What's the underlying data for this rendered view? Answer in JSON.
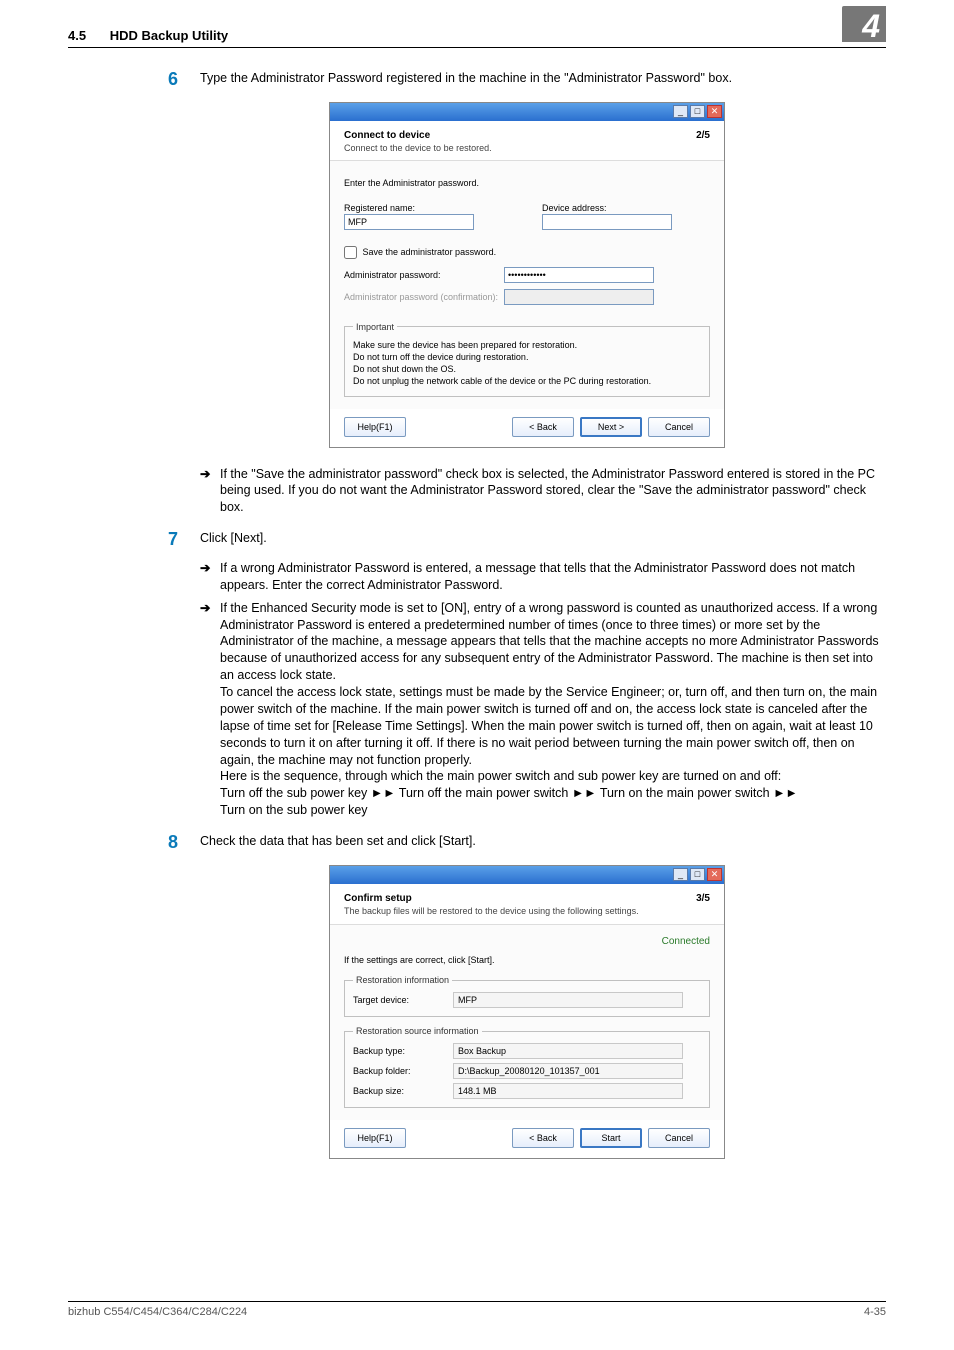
{
  "header": {
    "section_number": "4.5",
    "section_title": "HDD Backup Utility",
    "chapter_badge": "4"
  },
  "step6": {
    "num": "6",
    "text": "Type the Administrator Password registered in the machine in the \"Administrator Password\" box.",
    "arrow_text": "If the \"Save the administrator password\" check box is selected, the Administrator Password entered is stored in the PC being used. If you do not want the Administrator Password stored, clear the \"Save the administrator password\" check box."
  },
  "dlg1": {
    "title": "Connect to device",
    "subtitle": "Connect to the device to be restored.",
    "page_indicator": "2/5",
    "instruction": "Enter the Administrator password.",
    "reg_name_label": "Registered name:",
    "reg_name_value": "MFP",
    "dev_addr_label": "Device address:",
    "dev_addr_value": "",
    "save_pw_label": "Save the administrator password.",
    "admin_pw_label": "Administrator password:",
    "admin_pw_value": "••••••••••••",
    "admin_pw_conf_label": "Administrator password (confirmation):",
    "important_legend": "Important",
    "important_line1": "Make sure the device has been prepared for restoration.",
    "important_line2": "Do not turn off the device during restoration.",
    "important_line3": "Do not shut down the OS.",
    "important_line4": "Do not unplug the network cable of the device or the PC during restoration.",
    "btn_help": "Help(F1)",
    "btn_back": "< Back",
    "btn_next": "Next >",
    "btn_cancel": "Cancel"
  },
  "step7": {
    "num": "7",
    "text": "Click [Next].",
    "arrow1": "If a wrong Administrator Password is entered, a message that tells that the Administrator Password does not match appears. Enter the correct Administrator Password.",
    "arrow2_p1": "If the Enhanced Security mode is set to [ON], entry of a wrong password is counted as unauthorized access. If a wrong Administrator Password is entered a predetermined number of times (once to three times) or more set by the Administrator of the machine, a message appears that tells that the machine accepts no more Administrator Passwords because of unauthorized access for any subsequent entry of the Administrator Password. The machine is then set into an access lock state.",
    "arrow2_p2": "To cancel the access lock state, settings must be made by the Service Engineer; or, turn off, and then turn on, the main power switch of the machine. If the main power switch is turned off and on, the access lock state is canceled after the lapse of time set for [Release Time Settings]. When the main power switch is turned off, then on again, wait at least 10 seconds to turn it on after turning it off. If there is no wait period between turning the main power switch off, then on again, the machine may not function properly.",
    "arrow2_p3": "Here is the sequence, through which the main power switch and sub power key are turned on and off:",
    "arrow2_seq_a": "Turn off the sub power key",
    "arrow2_seq_b": "Turn off the main power switch",
    "arrow2_seq_c": "Turn on the main power switch",
    "arrow2_seq_d": "Turn on the sub power key"
  },
  "step8": {
    "num": "8",
    "text": "Check the data that has been set and click [Start]."
  },
  "dlg2": {
    "title": "Confirm setup",
    "subtitle": "The backup files will be restored to the device using the following settings.",
    "page_indicator": "3/5",
    "status": "Connected",
    "instruction": "If the settings are correct, click [Start].",
    "rest_info_legend": "Restoration information",
    "target_device_label": "Target device:",
    "target_device_value": "MFP",
    "src_info_legend": "Restoration source information",
    "backup_type_label": "Backup type:",
    "backup_type_value": "Box Backup",
    "backup_folder_label": "Backup folder:",
    "backup_folder_value": "D:\\Backup_20080120_101357_001",
    "backup_size_label": "Backup size:",
    "backup_size_value": "148.1 MB",
    "btn_help": "Help(F1)",
    "btn_back": "< Back",
    "btn_start": "Start",
    "btn_cancel": "Cancel"
  },
  "footer": {
    "left": "bizhub C554/C454/C364/C284/C224",
    "right": "4-35"
  },
  "glyphs": {
    "arrow_right": "➔",
    "seq_arrow": "►►"
  }
}
